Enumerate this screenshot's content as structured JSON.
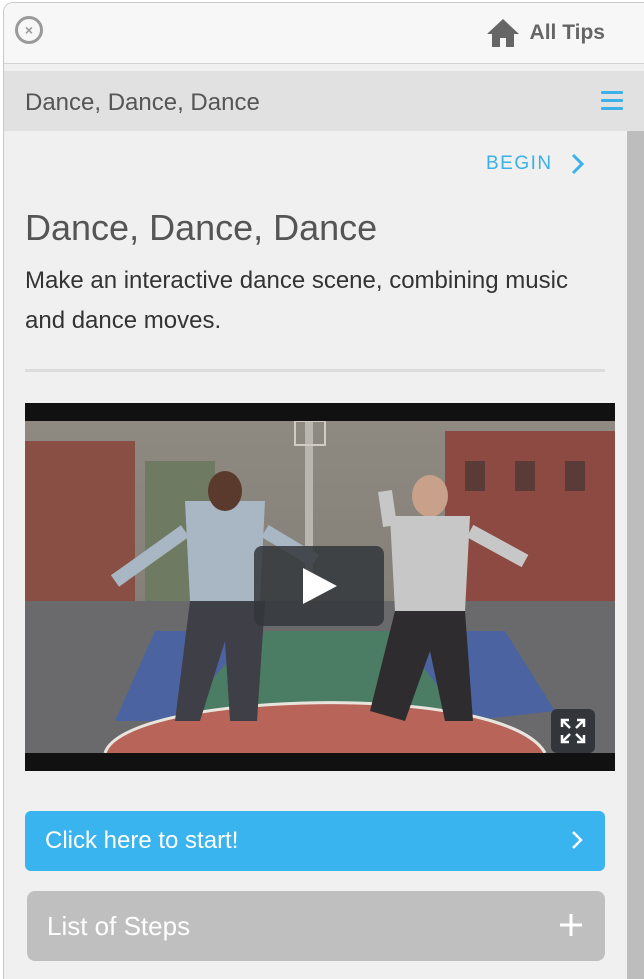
{
  "topbar": {
    "close_icon": "close-circle-icon",
    "all_tips_label": "All Tips",
    "home_icon": "home-icon"
  },
  "titlebar": {
    "title": "Dance, Dance, Dance",
    "menu_icon": "hamburger-menu-icon"
  },
  "content": {
    "begin_label": "BEGIN",
    "heading": "Dance, Dance, Dance",
    "description": "Make an interactive dance scene, combining music and dance moves."
  },
  "video": {
    "play_icon": "play-icon",
    "fullscreen_icon": "fullscreen-icon"
  },
  "actions": {
    "start_label": "Click here to start!",
    "steps_label": "List of Steps"
  },
  "colors": {
    "accent": "#3ab1e8",
    "start_button": "#3ab4ee",
    "steps_button": "#bfbfbf"
  }
}
